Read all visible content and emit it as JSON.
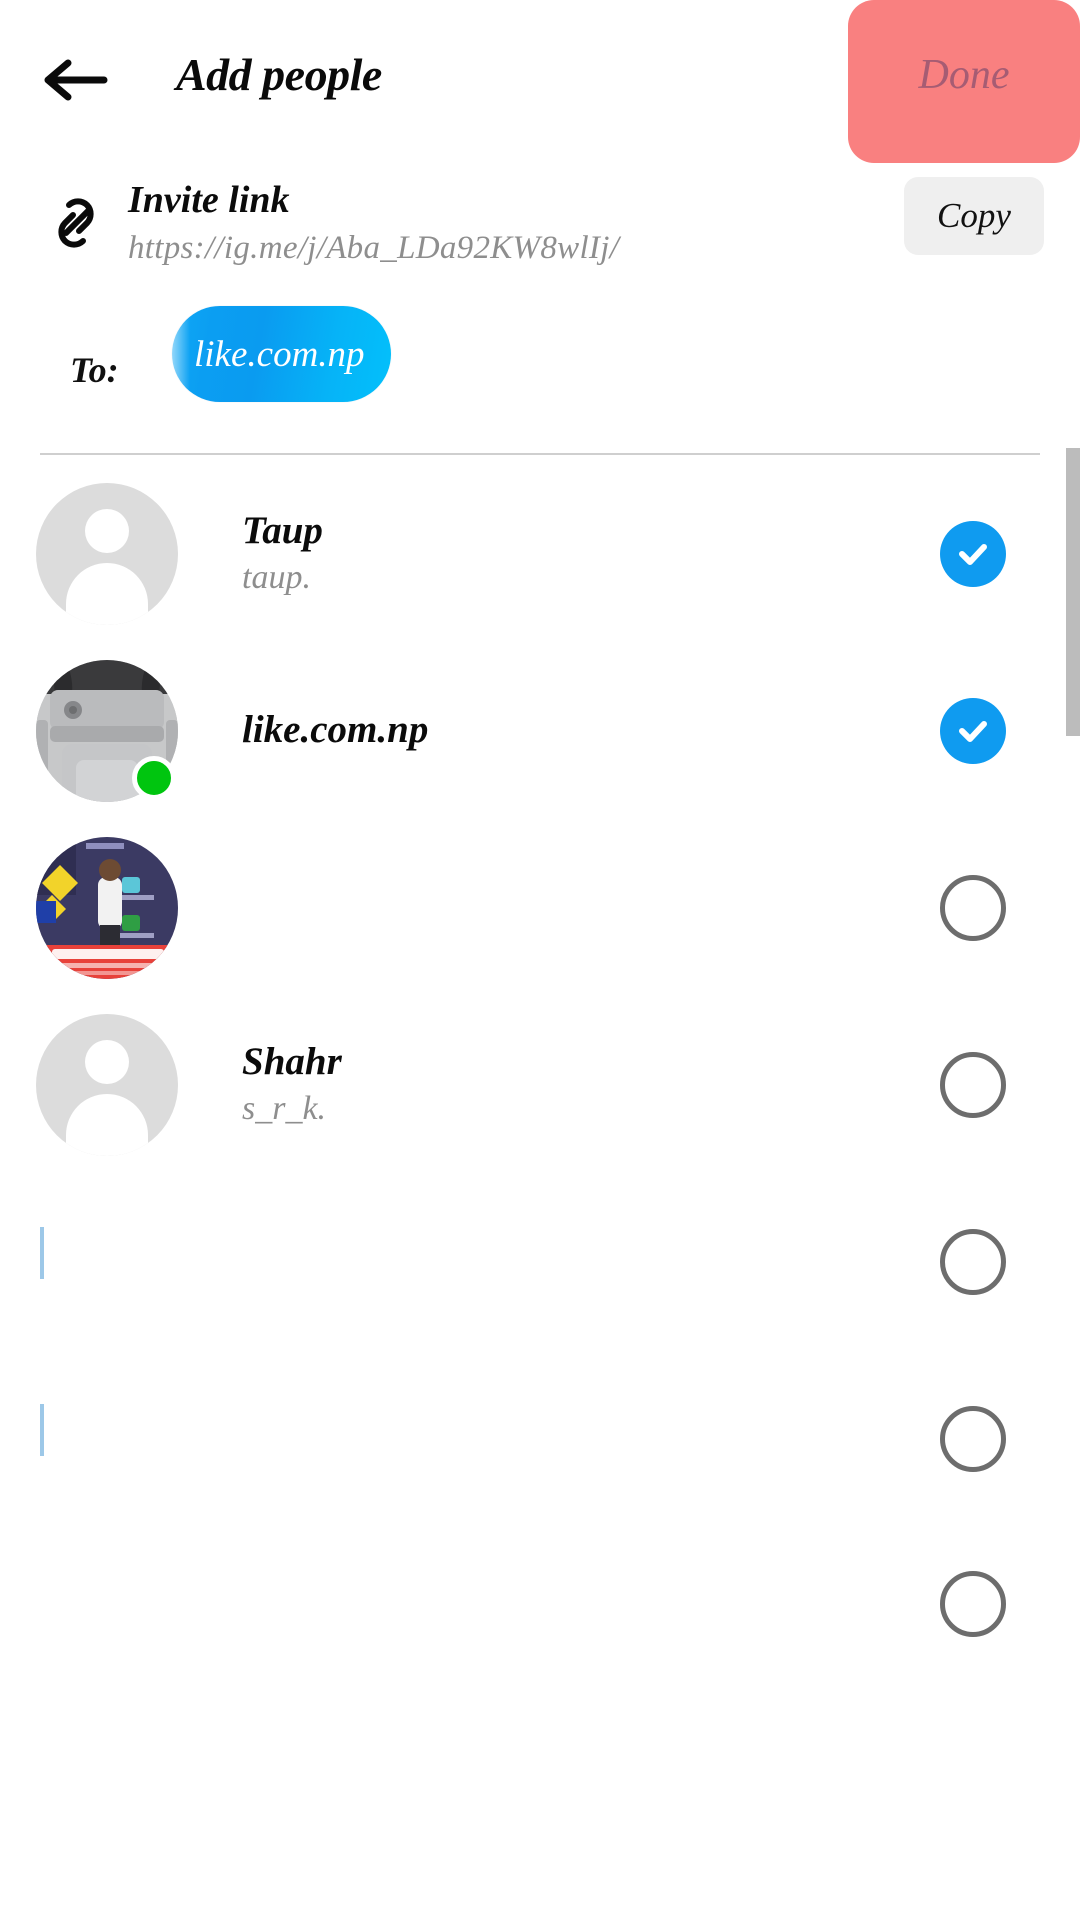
{
  "header": {
    "back_icon": "arrow-left-icon",
    "title": "Add people",
    "done_label": "Done",
    "done_color": "#f98080",
    "done_text_color": "#a05a72"
  },
  "invite": {
    "icon": "link-icon",
    "title": "Invite link",
    "url": "https://ig.me/j/Aba_LDa92KW8wlIj/",
    "copy_label": "Copy",
    "copy_bg": "#efefef"
  },
  "recipients": {
    "label": "To:",
    "chips": [
      {
        "label": "like.com.np",
        "color_start": "#0fa8f5",
        "color_end": "#03c0fb"
      }
    ]
  },
  "list": {
    "accent_checked": "#0f9bf0",
    "online_color": "#00c50f",
    "rows": [
      {
        "name": "Taup",
        "username": "taup.",
        "avatar": "placeholder-person-avatar",
        "selected": true,
        "online": false,
        "check_icon": "check-icon"
      },
      {
        "name": "like.com.np",
        "username": "",
        "avatar": "backpack-photo-avatar",
        "selected": true,
        "online": true,
        "check_icon": "check-icon"
      },
      {
        "name": "",
        "username": "",
        "avatar": "person-photo-avatar",
        "selected": false,
        "online": false,
        "check_icon": "circle-outline-icon"
      },
      {
        "name": "Shahr",
        "username": "s_r_k.",
        "avatar": "placeholder-person-avatar",
        "selected": false,
        "online": false,
        "check_icon": "circle-outline-icon"
      },
      {
        "name": "",
        "username": "",
        "avatar": "blank-avatar",
        "selected": false,
        "online": false,
        "check_icon": "circle-outline-icon"
      },
      {
        "name": "",
        "username": "",
        "avatar": "blank-avatar",
        "selected": false,
        "online": false,
        "check_icon": "circle-outline-icon"
      }
    ]
  },
  "scrollbar": {
    "name": "vertical-scrollbar",
    "color": "#bcbcbc"
  }
}
